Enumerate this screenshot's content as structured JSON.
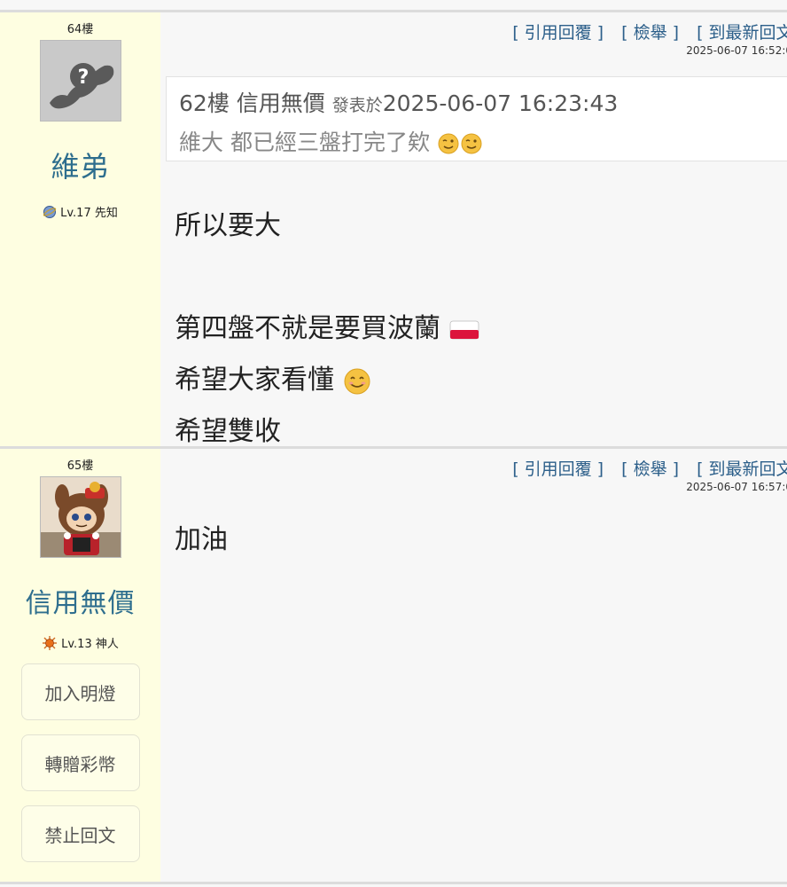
{
  "posts": [
    {
      "floor": "64樓",
      "username": "維弟",
      "level": "Lv.17 先知",
      "actions": [
        "[ 引用回覆 ]",
        "[ 檢舉 ]",
        "[ 到最新回文 ]"
      ],
      "timestamp": "2025-06-07 16:52:0",
      "quote": {
        "floor": "62樓",
        "author": "信用無價",
        "posted_prefix": "發表於",
        "posted_time": "2025-06-07 16:23:43",
        "text": "維大 都已經三盤打完了欸"
      },
      "lines": [
        "所以要大",
        "",
        "第四盤不就是要買波蘭",
        "希望大家看懂",
        "希望雙收"
      ]
    },
    {
      "floor": "65樓",
      "username": "信用無價",
      "level": "Lv.13 神人",
      "actions": [
        "[ 引用回覆 ]",
        "[ 檢舉 ]",
        "[ 到最新回文 ]"
      ],
      "timestamp": "2025-06-07 16:57:0",
      "lines": [
        "加油"
      ],
      "side_buttons": [
        "加入明燈",
        "轉贈彩幣",
        "禁止回文"
      ]
    }
  ]
}
